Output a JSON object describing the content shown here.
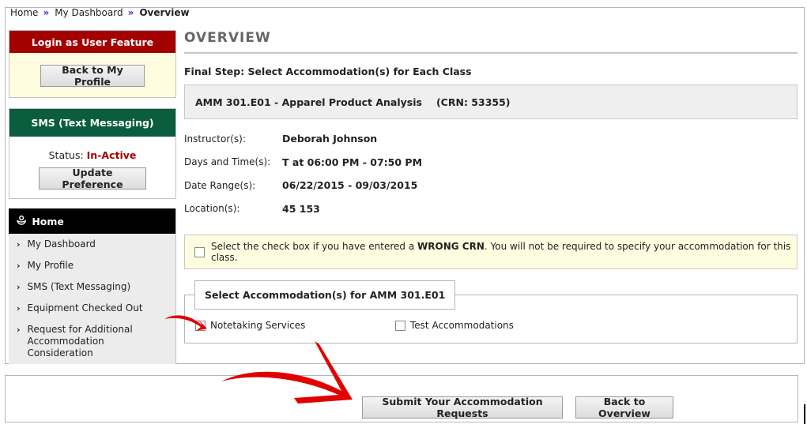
{
  "breadcrumb": {
    "items": [
      "Home",
      "My Dashboard",
      "Overview"
    ],
    "separator": "»"
  },
  "sidebar": {
    "login_box": {
      "title": "Login as User Feature",
      "button": "Back to My Profile"
    },
    "sms_box": {
      "title": "SMS (Text Messaging)",
      "status_label": "Status:",
      "status_value": "In-Active",
      "button": "Update Preference"
    },
    "nav": {
      "title": "Home",
      "items": [
        {
          "label": "My Dashboard"
        },
        {
          "label": "My Profile"
        },
        {
          "label": "SMS (Text Messaging)"
        },
        {
          "label": "Equipment Checked Out"
        },
        {
          "label": "Request for Additional Accommodation Consideration"
        }
      ]
    }
  },
  "content": {
    "title": "OVERVIEW",
    "step_title": "Final Step: Select Accommodation(s) for Each Class",
    "class": {
      "name": "AMM 301.E01 - Apparel Product Analysis",
      "crn": "(CRN: 53355)"
    },
    "info": [
      {
        "label": "Instructor(s):",
        "value": "Deborah Johnson"
      },
      {
        "label": "Days and Time(s):",
        "value": "T at 06:00 PM - 07:50 PM"
      },
      {
        "label": "Date Range(s):",
        "value": "06/22/2015 - 09/03/2015"
      },
      {
        "label": "Location(s):",
        "value": "45 153"
      }
    ],
    "wrong_crn": {
      "text_before": "Select the check box if you have entered a ",
      "text_bold": "WRONG CRN",
      "text_after": ". You will not be required to specify your accommodation for this class.",
      "checked": false
    },
    "accommodations": {
      "legend": "Select Accommodation(s) for AMM 301.E01",
      "options": [
        {
          "label": "Notetaking Services",
          "checked": false
        },
        {
          "label": "Test Accommodations",
          "checked": false
        }
      ]
    }
  },
  "actions": {
    "submit": "Submit Your Accommodation Requests",
    "back": "Back to Overview"
  },
  "annotation_color": "#e00000"
}
